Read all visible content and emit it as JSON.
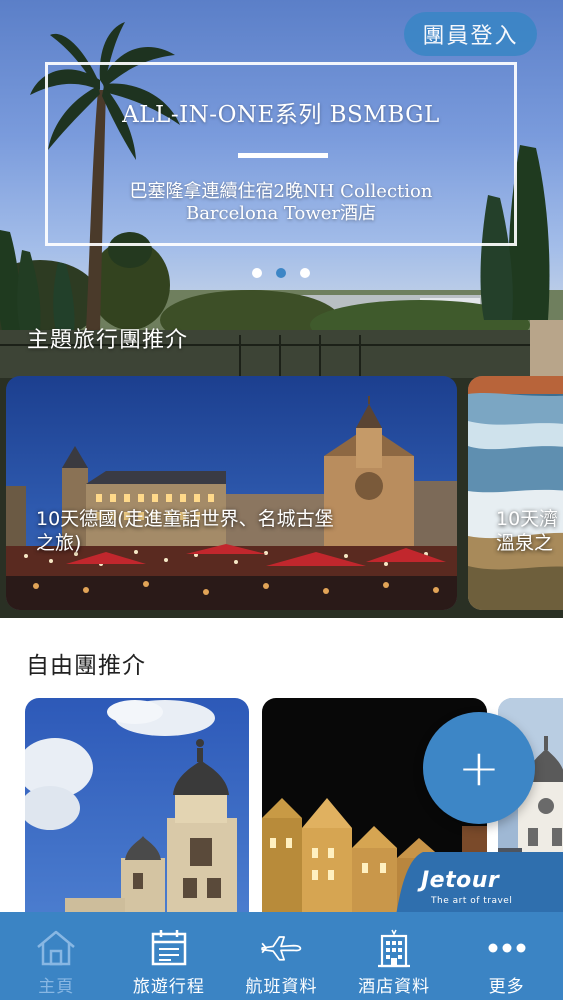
{
  "header": {
    "login_label": "團員登入"
  },
  "banner": {
    "title": "ALL-IN-ONE系列 BSMBGL",
    "subtitle_line1": "巴塞隆拿連續住宿2晚NH Collection",
    "subtitle_line2": "Barcelona Tower酒店",
    "active_slide": 2,
    "slide_count": 3
  },
  "theme_section": {
    "title": "主題旅行團推介",
    "cards": [
      {
        "caption_line1": "10天德國(走進童話世界、名城古堡",
        "caption_line2": "之旅)"
      },
      {
        "caption_line1": "10天濟",
        "caption_line2": "溫泉之"
      }
    ]
  },
  "free_section": {
    "title": "自由團推介"
  },
  "fab": {
    "label": "+"
  },
  "brand": {
    "name": "Jetour",
    "tagline": "The art of travel"
  },
  "tabbar": {
    "items": [
      {
        "label": "主頁",
        "icon": "home-icon",
        "active": true
      },
      {
        "label": "旅遊行程",
        "icon": "calendar-icon",
        "active": false
      },
      {
        "label": "航班資料",
        "icon": "airplane-icon",
        "active": false
      },
      {
        "label": "酒店資料",
        "icon": "hotel-icon",
        "active": false
      },
      {
        "label": "更多",
        "icon": "more-icon",
        "active": false
      }
    ]
  },
  "colors": {
    "accent": "#3b84c4",
    "active_tab_label": "#88b7e3"
  }
}
